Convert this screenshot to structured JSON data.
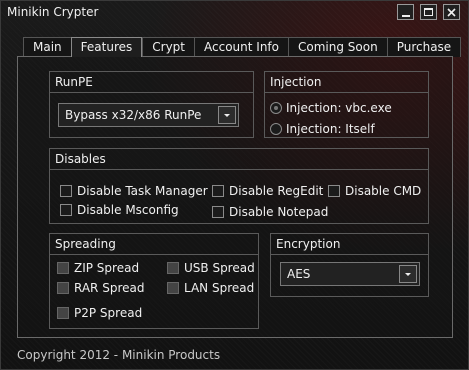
{
  "window": {
    "title": "Minikin Crypter"
  },
  "tabs": [
    {
      "label": "Main"
    },
    {
      "label": "Features",
      "active": true
    },
    {
      "label": "Crypt"
    },
    {
      "label": "Account Info"
    },
    {
      "label": "Coming Soon"
    },
    {
      "label": "Purchase"
    }
  ],
  "runpe": {
    "title": "RunPE",
    "selected": "Bypass x32/x86 RunPe"
  },
  "injection": {
    "title": "Injection",
    "options": [
      {
        "label": "Injection: vbc.exe",
        "selected": true
      },
      {
        "label": "Injection: Itself",
        "selected": false
      }
    ]
  },
  "disables": {
    "title": "Disables",
    "options": [
      {
        "label": "Disable Task Manager",
        "checked": false
      },
      {
        "label": "Disable RegEdit",
        "checked": false
      },
      {
        "label": "Disable CMD",
        "checked": false
      },
      {
        "label": "Disable Msconfig",
        "checked": false
      },
      {
        "label": "Disable Notepad",
        "checked": false
      }
    ]
  },
  "spreading": {
    "title": "Spreading",
    "options": [
      {
        "label": "ZIP Spread",
        "checked": false
      },
      {
        "label": "USB Spread",
        "checked": false
      },
      {
        "label": "RAR Spread",
        "checked": false
      },
      {
        "label": "LAN Spread",
        "checked": false
      },
      {
        "label": "P2P Spread",
        "checked": false
      }
    ]
  },
  "encryption": {
    "title": "Encryption",
    "selected": "AES"
  },
  "footer": {
    "copyright": "Copyright 2012 - Minikin Products"
  }
}
